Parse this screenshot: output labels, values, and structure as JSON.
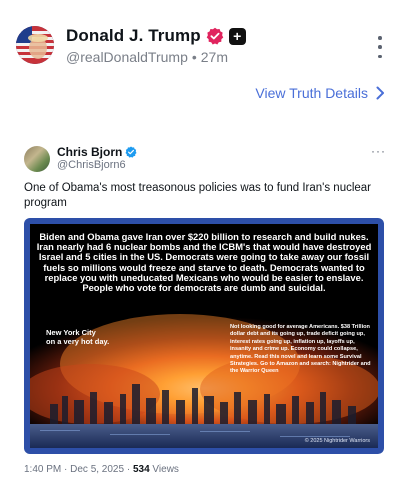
{
  "post": {
    "author_name": "Donald J. Trump",
    "handle": "@realDonaldTrump",
    "separator": "•",
    "age": "27m",
    "view_link": "View Truth Details",
    "view_link_icon": "chevron-right-icon",
    "verified_color": "#e0245e",
    "link_color": "#4a6fd8"
  },
  "quoted": {
    "author_name": "Chris Bjorn",
    "handle": "@ChrisBjorn6",
    "verified_color": "#1d9bf0",
    "text": "One of Obama's most treasonous policies was to fund Iran's nuclear program",
    "image": {
      "headline": "Biden and Obama gave Iran over $220 billion to research and build nukes. Iran nearly had 6 nuclear bombs and the ICBM's that would have destroyed Israel and 5 cities in the US. Democrats were going to take away our fossil fuels so millions would freeze and starve to death. Democrats wanted to replace you with uneducated Mexicans who would be easier to enslave. People who vote for democrats are dumb and suicidal.",
      "city_label_1": "New York City",
      "city_label_2": "on a very hot day.",
      "side_text": "Not looking good for average Americans. $38 Trillion dollar debt and its going up, trade deficit going up, interest rates going up, inflation up, layoffs up, insanity and crime up. Economy could collapse, anytime. Read this novel and learn some Survival Strategies. Go to Amazon and search: Nightrider and the Warrior Queen",
      "copyright": "© 2025 Nightrider Warriors"
    },
    "time": "1:40 PM · Dec 5, 2025 ·",
    "views_count": "534",
    "views_label": "Views"
  }
}
